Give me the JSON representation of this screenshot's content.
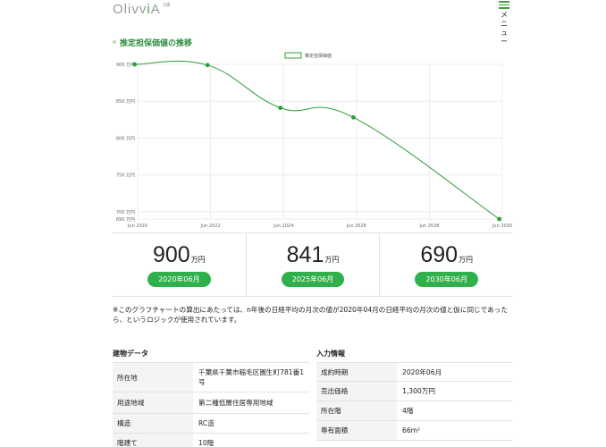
{
  "header": {
    "logo_main": "Olivv",
    "logo_accent": "i",
    "logo_tail": "A",
    "logo_sup": "β版",
    "menu_label": "メニュー"
  },
  "section": {
    "title": "推定担保価値の推移"
  },
  "chart_data": {
    "type": "line",
    "legend": "推定担保価値",
    "x_ticks": [
      "Jun 2020",
      "Jun 2022",
      "Jun 2024",
      "Jun 2026",
      "Jun 2028",
      "Jun 2030"
    ],
    "y_ticks": [
      {
        "v": 900,
        "label": "900 万円"
      },
      {
        "v": 850,
        "label": "850 万円"
      },
      {
        "v": 800,
        "label": "800 万円"
      },
      {
        "v": 750,
        "label": "750 万円"
      },
      {
        "v": 700,
        "label": "700 万円"
      },
      {
        "v": 690,
        "label": "690 万円"
      }
    ],
    "ylim": [
      690,
      900
    ],
    "series": [
      {
        "name": "推定担保価値",
        "color": "#2e9e3a",
        "points": [
          {
            "x": "2020-06",
            "y": 900
          },
          {
            "x": "2022-06",
            "y": 899
          },
          {
            "x": "2024-06",
            "y": 841
          },
          {
            "x": "2026-06",
            "y": 828
          },
          {
            "x": "2030-06",
            "y": 690
          }
        ]
      }
    ]
  },
  "stats": [
    {
      "value": "900",
      "unit": "万円",
      "date": "2020年06月"
    },
    {
      "value": "841",
      "unit": "万円",
      "date": "2025年06月"
    },
    {
      "value": "690",
      "unit": "万円",
      "date": "2030年06月"
    }
  ],
  "note": "※このグラフチャートの算出にあたっては、n年後の日経平均の月次の値が2020年04月の日経平均の月次の値と仮に同じであったら、というロジックが使用されています。",
  "building": {
    "title": "建物データ",
    "rows": [
      {
        "k": "所在地",
        "v": "千葉県千葉市稲毛区園生町781番1号"
      },
      {
        "k": "用途地域",
        "v": "第二種低層住居専用地域"
      },
      {
        "k": "構造",
        "v": "RC造"
      },
      {
        "k": "階建て",
        "v": "10階"
      }
    ]
  },
  "input": {
    "title": "入力情報",
    "rows": [
      {
        "k": "成約時期",
        "v": "2020年06月"
      },
      {
        "k": "売出価格",
        "v": "1,300万円"
      },
      {
        "k": "所在階",
        "v": "4階"
      },
      {
        "k": "専有面積",
        "v": "66m²"
      }
    ]
  }
}
